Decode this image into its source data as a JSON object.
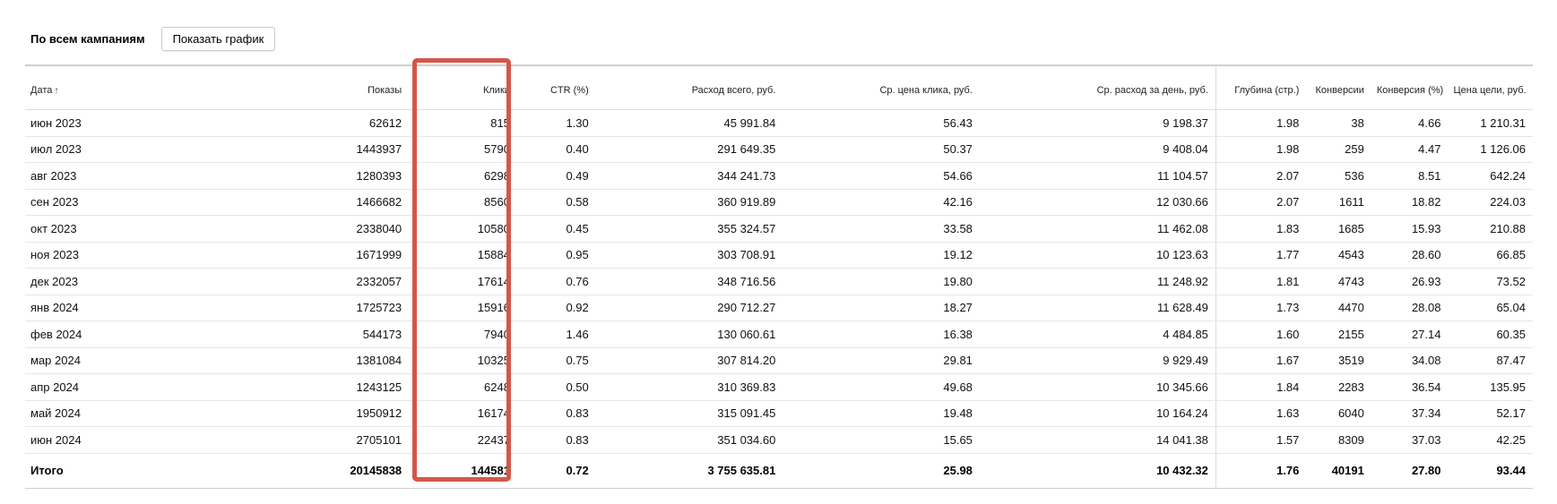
{
  "header": {
    "title": "По всем кампаниям",
    "chart_button_label": "Показать график"
  },
  "table": {
    "columns": [
      {
        "key": "date",
        "label": "Дата",
        "sort_indicator": "↑"
      },
      {
        "key": "impressions",
        "label": "Показы"
      },
      {
        "key": "clicks",
        "label": "Клики"
      },
      {
        "key": "ctr",
        "label": "CTR (%)"
      },
      {
        "key": "spend",
        "label": "Расход всего, руб."
      },
      {
        "key": "cpc",
        "label": "Ср. цена клика, руб."
      },
      {
        "key": "daily_spend",
        "label": "Ср. расход за день, руб."
      },
      {
        "key": "depth",
        "label": "Глубина (стр.)"
      },
      {
        "key": "conversions",
        "label": "Конверсии"
      },
      {
        "key": "conv_rate",
        "label": "Конверсия (%)"
      },
      {
        "key": "goal_cost",
        "label": "Цена цели, руб."
      }
    ],
    "rows": [
      [
        "июн 2023",
        "62612",
        "815",
        "1.30",
        "45 991.84",
        "56.43",
        "9 198.37",
        "1.98",
        "38",
        "4.66",
        "1 210.31"
      ],
      [
        "июл 2023",
        "1443937",
        "5790",
        "0.40",
        "291 649.35",
        "50.37",
        "9 408.04",
        "1.98",
        "259",
        "4.47",
        "1 126.06"
      ],
      [
        "авг 2023",
        "1280393",
        "6298",
        "0.49",
        "344 241.73",
        "54.66",
        "11 104.57",
        "2.07",
        "536",
        "8.51",
        "642.24"
      ],
      [
        "сен 2023",
        "1466682",
        "8560",
        "0.58",
        "360 919.89",
        "42.16",
        "12 030.66",
        "2.07",
        "1611",
        "18.82",
        "224.03"
      ],
      [
        "окт 2023",
        "2338040",
        "10580",
        "0.45",
        "355 324.57",
        "33.58",
        "11 462.08",
        "1.83",
        "1685",
        "15.93",
        "210.88"
      ],
      [
        "ноя 2023",
        "1671999",
        "15884",
        "0.95",
        "303 708.91",
        "19.12",
        "10 123.63",
        "1.77",
        "4543",
        "28.60",
        "66.85"
      ],
      [
        "дек 2023",
        "2332057",
        "17614",
        "0.76",
        "348 716.56",
        "19.80",
        "11 248.92",
        "1.81",
        "4743",
        "26.93",
        "73.52"
      ],
      [
        "янв 2024",
        "1725723",
        "15916",
        "0.92",
        "290 712.27",
        "18.27",
        "11 628.49",
        "1.73",
        "4470",
        "28.08",
        "65.04"
      ],
      [
        "фев 2024",
        "544173",
        "7940",
        "1.46",
        "130 060.61",
        "16.38",
        "4 484.85",
        "1.60",
        "2155",
        "27.14",
        "60.35"
      ],
      [
        "мар 2024",
        "1381084",
        "10325",
        "0.75",
        "307 814.20",
        "29.81",
        "9 929.49",
        "1.67",
        "3519",
        "34.08",
        "87.47"
      ],
      [
        "апр 2024",
        "1243125",
        "6248",
        "0.50",
        "310 369.83",
        "49.68",
        "10 345.66",
        "1.84",
        "2283",
        "36.54",
        "135.95"
      ],
      [
        "май 2024",
        "1950912",
        "16174",
        "0.83",
        "315 091.45",
        "19.48",
        "10 164.24",
        "1.63",
        "6040",
        "37.34",
        "52.17"
      ],
      [
        "июн 2024",
        "2705101",
        "22437",
        "0.83",
        "351 034.60",
        "15.65",
        "14 041.38",
        "1.57",
        "8309",
        "37.03",
        "42.25"
      ]
    ],
    "totals": [
      "Итого",
      "20145838",
      "144581",
      "0.72",
      "3 755 635.81",
      "25.98",
      "10 432.32",
      "1.76",
      "40191",
      "27.80",
      "93.44"
    ]
  },
  "highlight_color": "#d3574a"
}
